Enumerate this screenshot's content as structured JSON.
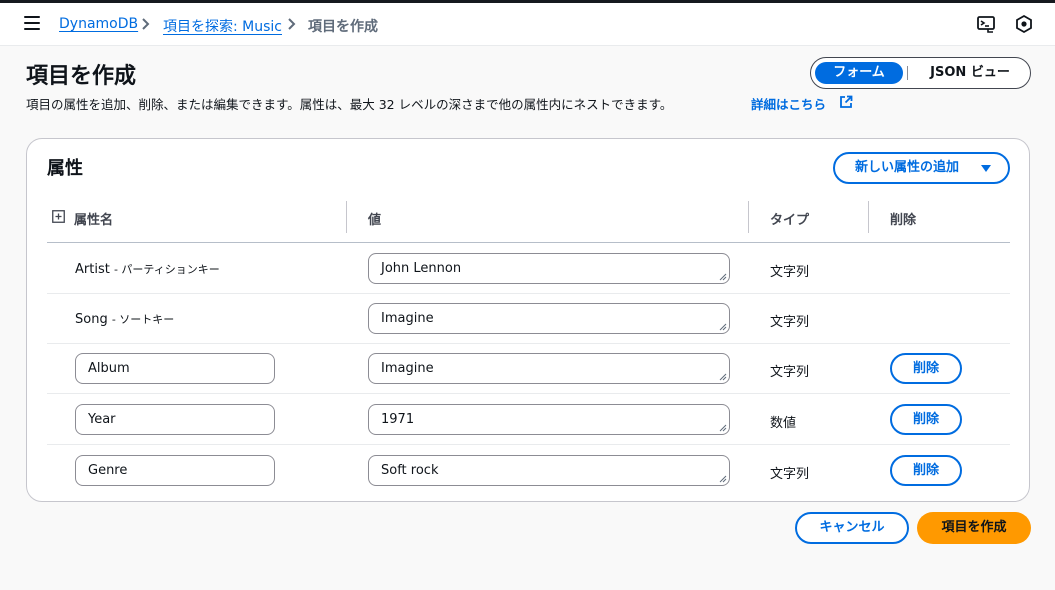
{
  "breadcrumb": {
    "items": [
      "DynamoDB",
      "項目を探索: Music",
      "項目を作成"
    ]
  },
  "icons": {
    "menu": "hamburger-icon",
    "chevron": "chevron-right-icon",
    "cloudshell": "cloudshell-icon",
    "settings": "settings-hex-icon",
    "external": "external-link-icon",
    "expand": "expand-square-icon",
    "caret": "caret-down-icon"
  },
  "page": {
    "title": "項目を作成",
    "description": "項目の属性を追加、削除、または編集できます。属性は、最大 32 レベルの深さまで他の属性内にネストできます。",
    "learn_more": "詳細はこちら"
  },
  "view_toggle": {
    "form_label": "フォーム",
    "json_label": "JSON ビュー",
    "selected": "フォーム"
  },
  "attributes": {
    "title": "属性",
    "add_button": "新しい属性の追加",
    "columns": [
      "属性名",
      "値",
      "タイプ",
      "削除"
    ],
    "rows": [
      {
        "name": "Artist",
        "suffix": "- パーティションキー",
        "editable_name": false,
        "value": "John Lennon",
        "type": "文字列",
        "deletable": false
      },
      {
        "name": "Song",
        "suffix": "- ソートキー",
        "editable_name": false,
        "value": "Imagine",
        "type": "文字列",
        "deletable": false
      },
      {
        "name": "Album",
        "suffix": "",
        "editable_name": true,
        "value": "Imagine",
        "type": "文字列",
        "deletable": true
      },
      {
        "name": "Year",
        "suffix": "",
        "editable_name": true,
        "value": "1971",
        "type": "数値",
        "deletable": true
      },
      {
        "name": "Genre",
        "suffix": "",
        "editable_name": true,
        "value": "Soft rock",
        "type": "文字列",
        "deletable": true
      }
    ],
    "delete_label": "削除"
  },
  "actions": {
    "cancel": "キャンセル",
    "create": "項目を作成"
  },
  "colors": {
    "link": "#006ce0",
    "primary": "#ff9900",
    "border": "#c6c6cd"
  }
}
